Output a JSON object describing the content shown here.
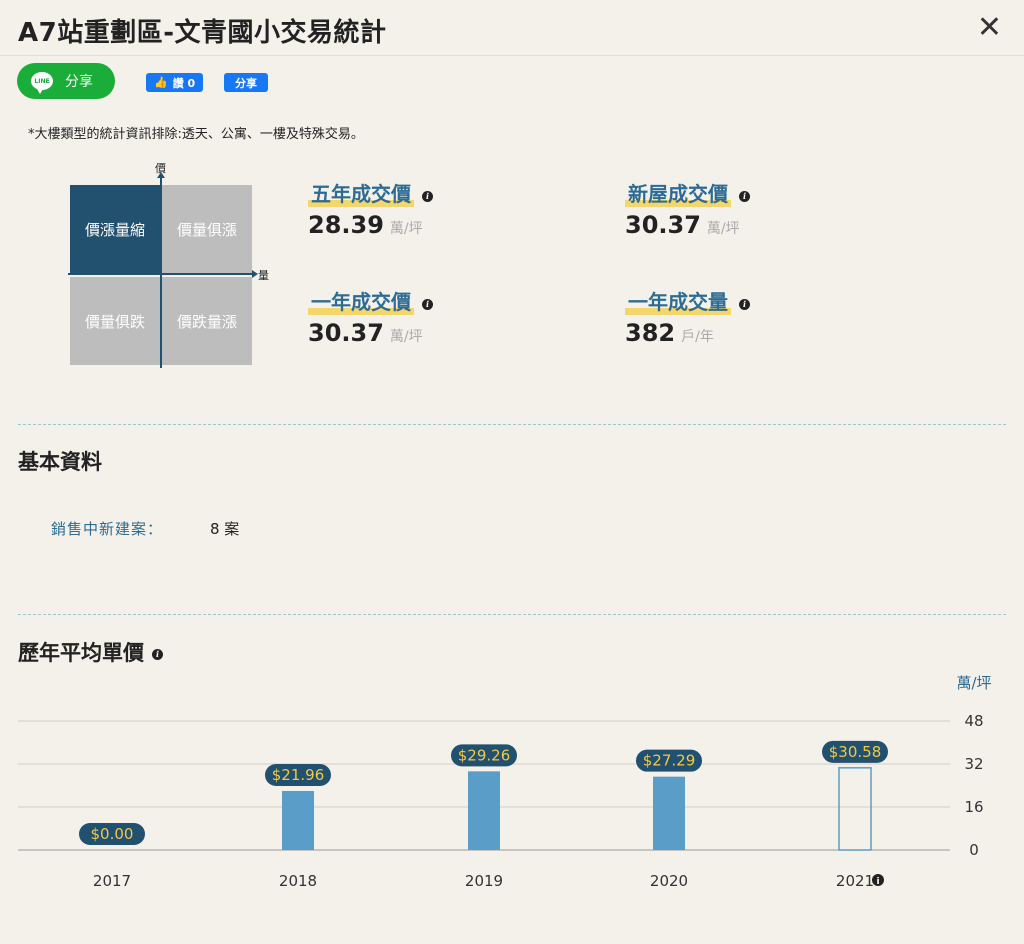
{
  "header": {
    "title": "A7站重劃區-文青國小交易統計"
  },
  "share": {
    "line_logo": "LINE",
    "line_label": "分享",
    "fb_like_label": "讚 0",
    "fb_share_label": "分享"
  },
  "note": "*大樓類型的統計資訊排除:透天、公寓、一樓及特殊交易。",
  "quadrant": {
    "axis_y": "價",
    "axis_x": "量",
    "cells": [
      "價漲量縮",
      "價量俱漲",
      "價量俱跌",
      "價跌量漲"
    ],
    "active_index": 0
  },
  "stats": [
    {
      "label": "五年成交價",
      "value": "28.39",
      "unit": "萬/坪"
    },
    {
      "label": "新屋成交價",
      "value": "30.37",
      "unit": "萬/坪"
    },
    {
      "label": "一年成交價",
      "value": "30.37",
      "unit": "萬/坪"
    },
    {
      "label": "一年成交量",
      "value": "382",
      "unit": "戶/年"
    }
  ],
  "basic": {
    "title": "基本資料",
    "label": "銷售中新建案：",
    "value": "8 案"
  },
  "history": {
    "title": "歷年平均單價",
    "unit": "萬/坪"
  },
  "chart_data": {
    "type": "bar",
    "categories": [
      "2017",
      "2018",
      "2019",
      "2020",
      "2021"
    ],
    "values": [
      0.0,
      21.96,
      29.26,
      27.29,
      30.58
    ],
    "data_labels": [
      "$0.00",
      "$21.96",
      "$29.26",
      "$27.29",
      "$30.58"
    ],
    "ylabel": "萬/坪",
    "ylim": [
      0,
      48
    ],
    "yticks": [
      "48",
      "32",
      "16",
      "0"
    ],
    "colors": {
      "bar": "#5b9dc9",
      "label_bg": "#22506f",
      "label_text": "#f5c842"
    },
    "last_bar_outlined": true,
    "grid": true
  }
}
